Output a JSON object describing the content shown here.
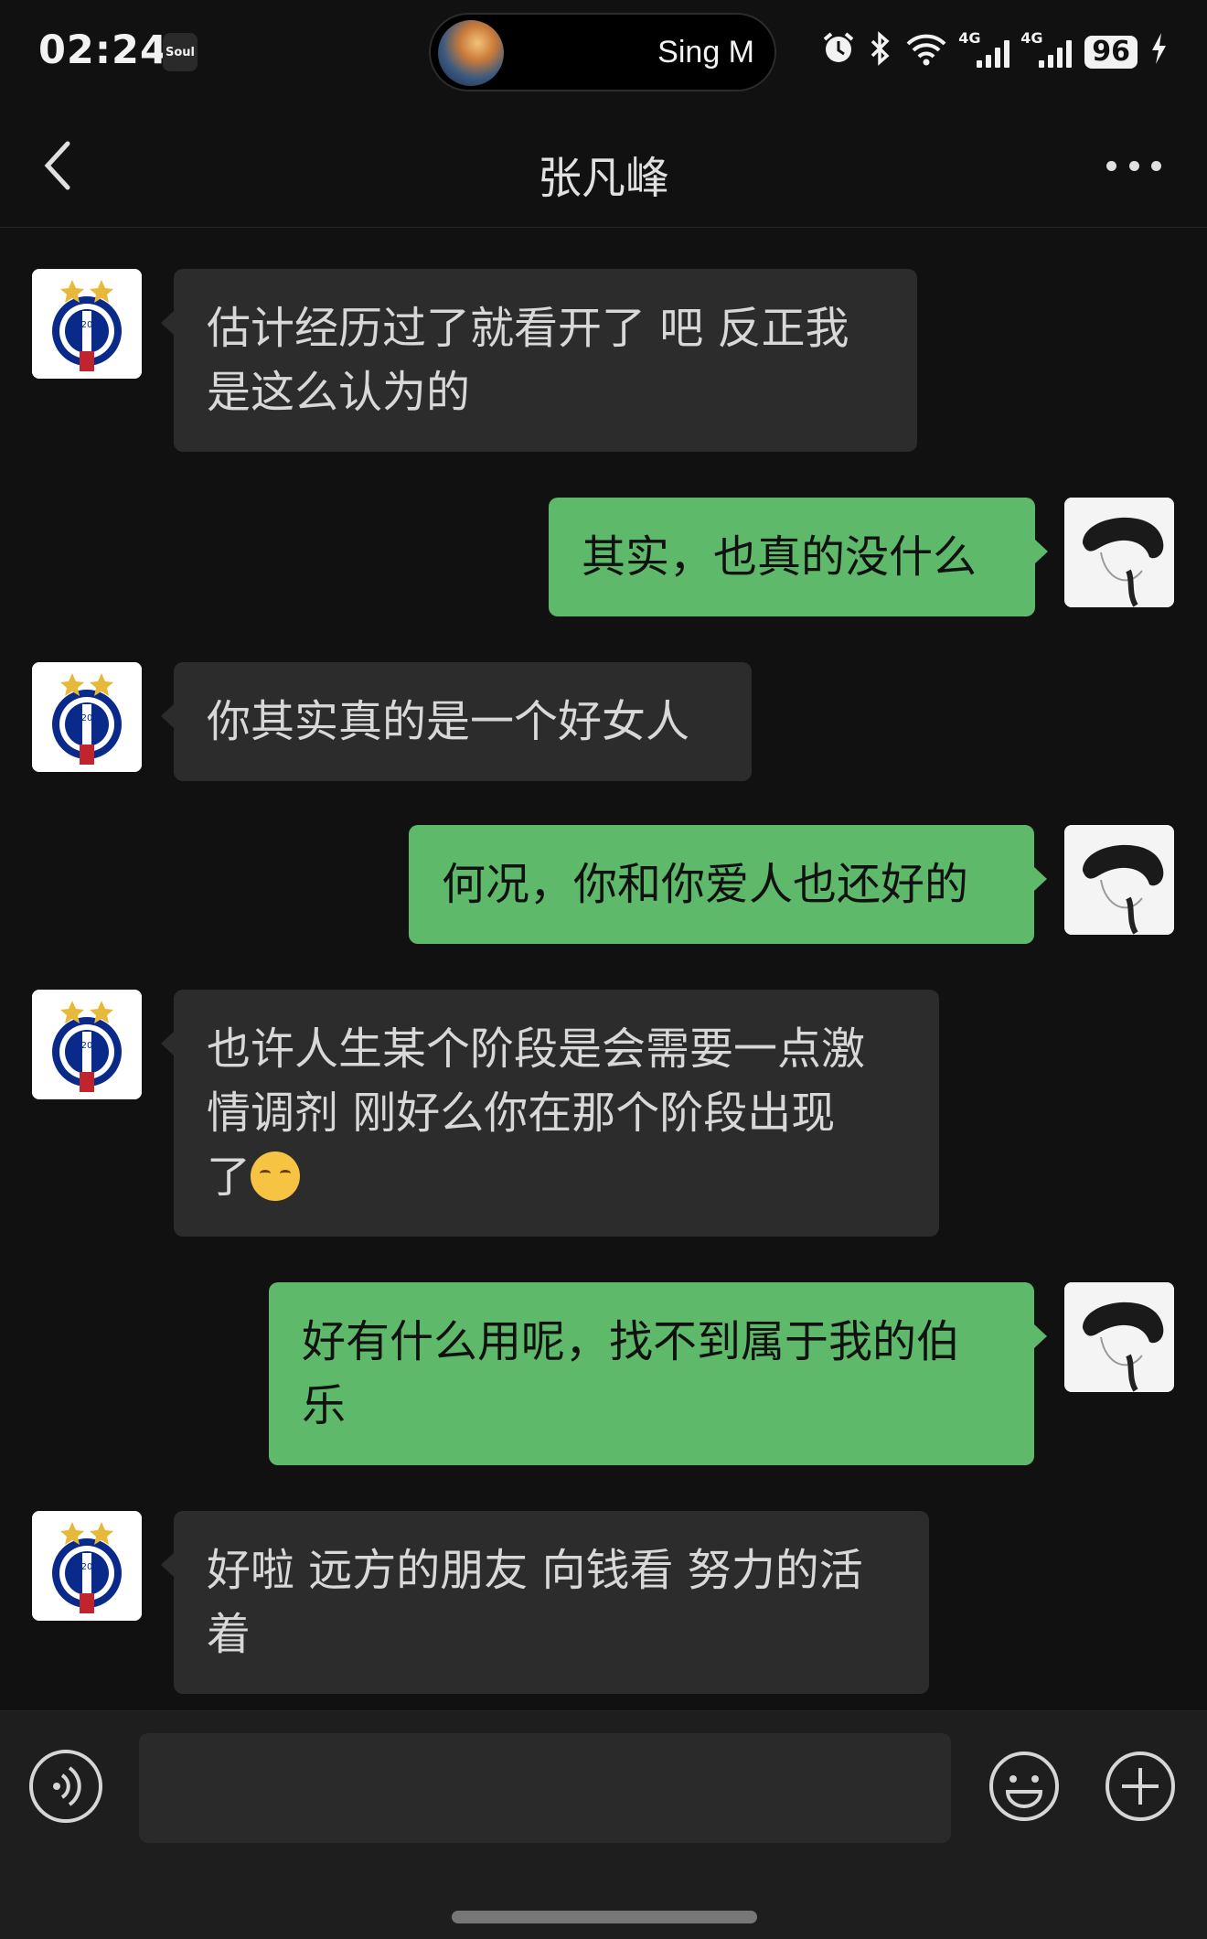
{
  "status_bar": {
    "time": "02:24",
    "soul_app_label": "Soul",
    "now_playing": "Sing M",
    "network_1": "4G",
    "network_2": "4G",
    "battery": "96"
  },
  "header": {
    "title": "张凡峰"
  },
  "messages": [
    {
      "direction": "in",
      "text": "估计经历过了就看开了 吧 反正我\n是这么认为的"
    },
    {
      "direction": "out",
      "text": "其实，也真的没什么"
    },
    {
      "direction": "in",
      "text": "你其实真的是一个好女人"
    },
    {
      "direction": "out",
      "text": "何况，你和你爱人也还好的"
    },
    {
      "direction": "in",
      "text": "也许人生某个阶段是会需要一点激\n情调剂 刚好么你在那个阶段出现\n了",
      "emoji": "smiling-face-emoji"
    },
    {
      "direction": "out",
      "text": "好有什么用呢，找不到属于我的伯\n乐"
    },
    {
      "direction": "in",
      "text": "好啦 远方的朋友 向钱看 努力的活\n着"
    }
  ],
  "input_bar": {
    "value": ""
  }
}
